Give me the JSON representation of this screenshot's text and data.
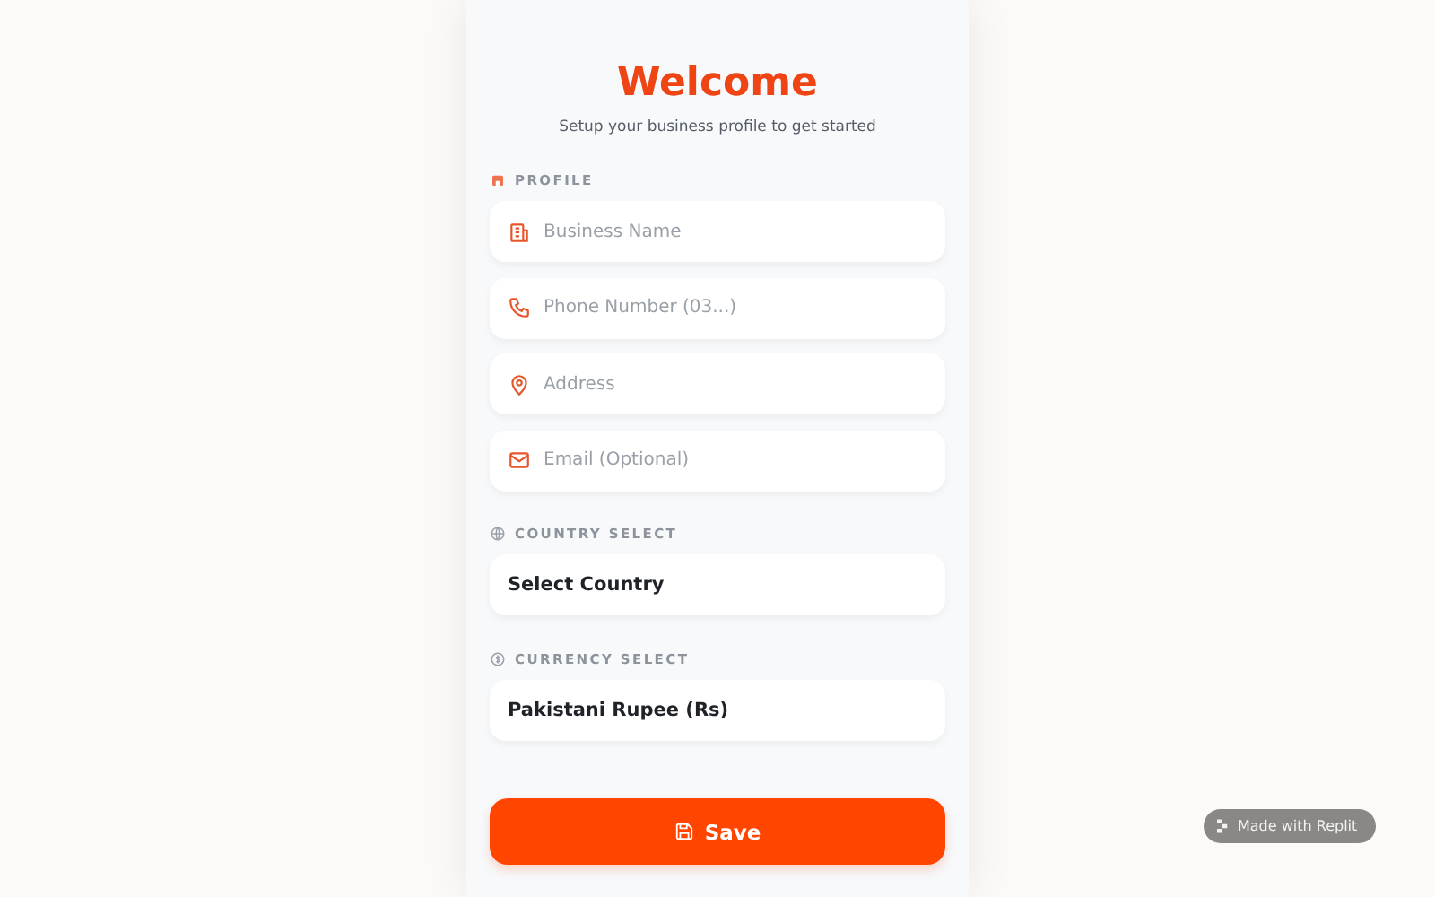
{
  "header": {
    "title": "Welcome",
    "subtitle": "Setup your business profile to get started"
  },
  "sections": [
    {
      "label": "PROFILE",
      "fields": [
        {
          "kind": "input",
          "placeholder": "Business Name"
        },
        {
          "kind": "input",
          "placeholder": "Phone Number (03...)"
        },
        {
          "kind": "input",
          "placeholder": "Address"
        },
        {
          "kind": "input",
          "placeholder": "Email (Optional)"
        }
      ]
    },
    {
      "label": "COUNTRY SELECT",
      "fields": [
        {
          "kind": "select",
          "value": "Select Country"
        }
      ]
    },
    {
      "label": "CURRENCY SELECT",
      "fields": [
        {
          "kind": "select",
          "value": "Pakistani Rupee (Rs)"
        }
      ]
    }
  ],
  "save_button": {
    "label": "Save"
  },
  "badge": {
    "label": "Made with Replit"
  }
}
